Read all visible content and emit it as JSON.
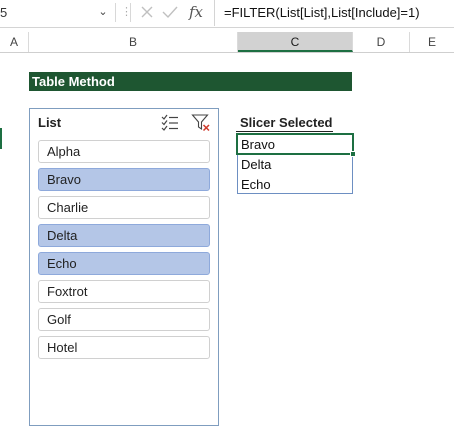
{
  "formula_bar": {
    "name_box": "5",
    "dropdown_glyph": "⌄",
    "handle_glyph": "⋮",
    "cancel_glyph": "✕",
    "enter_glyph": "✓",
    "function_glyph": "fx",
    "formula": "=FILTER(List[List],List[Include]=1)"
  },
  "columns": [
    "A",
    "B",
    "C",
    "D",
    "E"
  ],
  "active_column": "C",
  "sheet": {
    "table_header": "Table Method",
    "slicer": {
      "title": "List",
      "icons": [
        "multi-select-icon",
        "clear-filter-icon"
      ],
      "items": [
        {
          "label": "Alpha",
          "selected": false
        },
        {
          "label": "Bravo",
          "selected": true
        },
        {
          "label": "Charlie",
          "selected": false
        },
        {
          "label": "Delta",
          "selected": true
        },
        {
          "label": "Echo",
          "selected": true
        },
        {
          "label": "Foxtrot",
          "selected": false
        },
        {
          "label": "Golf",
          "selected": false
        },
        {
          "label": "Hotel",
          "selected": false
        }
      ]
    },
    "selected_header": "Slicer Selected",
    "selected_values": [
      "Bravo",
      "Delta",
      "Echo"
    ]
  },
  "colors": {
    "header_green": "#1e5631",
    "selection_green": "#1d6f42",
    "slicer_selected": "#b4c6e7",
    "slicer_border": "#7f9dbf"
  }
}
